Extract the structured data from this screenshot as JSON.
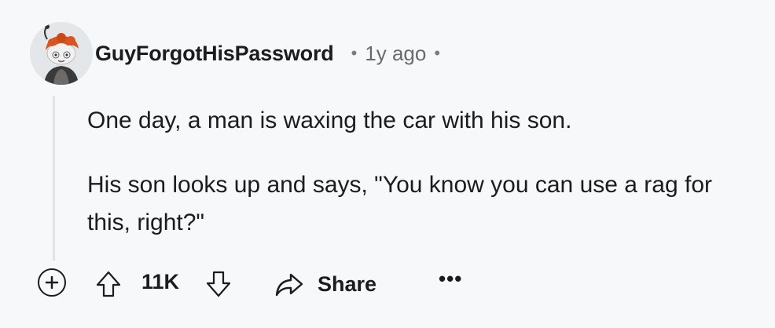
{
  "comment": {
    "username": "GuyForgotHisPassword",
    "separator": "•",
    "age": "1y ago",
    "paragraphs": [
      "One day, a man is waxing the car with his son.",
      "His son looks up and says, \"You know you can use a rag for this, right?\""
    ]
  },
  "actions": {
    "expand_icon": "plus-circle-icon",
    "upvote_icon": "arrow-up-icon",
    "score": "11K",
    "downvote_icon": "arrow-down-icon",
    "share_icon": "share-arrow-icon",
    "share_label": "Share",
    "more_label": "•••"
  },
  "colors": {
    "background": "#f7f8fa",
    "text": "#1c1c1c",
    "muted": "#6a6a6a",
    "thread_line": "#e1e3e6"
  }
}
